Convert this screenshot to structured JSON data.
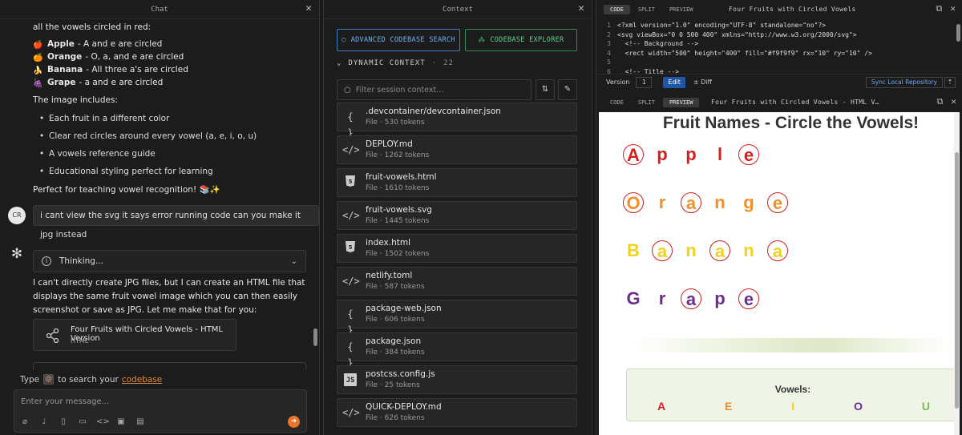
{
  "chat": {
    "header": "Chat",
    "intro_line": "all the vowels circled in red:",
    "fruits": [
      {
        "emoji": "🍎",
        "name": "Apple",
        "desc": "- A and e are circled"
      },
      {
        "emoji": "🍊",
        "name": "Orange",
        "desc": "- O, a, and e are circled"
      },
      {
        "emoji": "🍌",
        "name": "Banana",
        "desc": "- All three a's are circled"
      },
      {
        "emoji": "🍇",
        "name": "Grape",
        "desc": "- a and e are circled"
      }
    ],
    "includes_line": "The image includes:",
    "bullets": [
      "Each fruit in a different color",
      "Clear red circles around every vowel (a, e, i, o, u)",
      "A vowels reference guide",
      "Educational styling perfect for learning"
    ],
    "closing_line": "Perfect for teaching vowel recognition! 📚✨",
    "user_avatar": "CR",
    "user_message": "i cant view the svg it says error running code can you make it jpg instead",
    "thinking_label": "Thinking...",
    "ai_reply": "I can't directly create JPG files, but I can create an HTML file that displays the same fruit vowel image which you can then easily screenshot or save as JPG. Let me make that for you:",
    "artifact_title": "Four Fruits with Circled Vowels - HTML Version",
    "artifact_type": "HTML",
    "type_hint_pre": "Type",
    "type_hint_at": "@",
    "type_hint_mid": "to search your",
    "type_hint_link": "codebase",
    "input_placeholder": "Enter your message..."
  },
  "context": {
    "header": "Context",
    "search_btn": "ADVANCED CODEBASE SEARCH",
    "explorer_btn": "CODEBASE EXPLORER",
    "dynamic_label": "DYNAMIC CONTEXT",
    "dynamic_count": "22",
    "filter_placeholder": "Filter session context...",
    "files": [
      {
        "icon": "{ }",
        "name": ".devcontainer/devcontainer.json",
        "meta": "File · 530 tokens"
      },
      {
        "icon": "</>",
        "name": "DEPLOY.md",
        "meta": "File · 1262 tokens"
      },
      {
        "icon": "5",
        "name": "fruit-vowels.html",
        "meta": "File · 1610 tokens"
      },
      {
        "icon": "</>",
        "name": "fruit-vowels.svg",
        "meta": "File · 1445 tokens"
      },
      {
        "icon": "5",
        "name": "index.html",
        "meta": "File · 1502 tokens"
      },
      {
        "icon": "</>",
        "name": "netlify.toml",
        "meta": "File · 587 tokens"
      },
      {
        "icon": "{ }",
        "name": "package-web.json",
        "meta": "File · 606 tokens"
      },
      {
        "icon": "{ }",
        "name": "package.json",
        "meta": "File · 384 tokens"
      },
      {
        "icon": "JS",
        "name": "postcss.config.js",
        "meta": "File · 25 tokens"
      },
      {
        "icon": "</>",
        "name": "QUICK-DEPLOY.md",
        "meta": "File · 626 tokens"
      }
    ]
  },
  "code": {
    "tabs": [
      "CODE",
      "SPLIT",
      "PREVIEW"
    ],
    "title": "Four Fruits with Circled Vowels",
    "lines": [
      "<?xml version=\"1.0\" encoding=\"UTF-8\" standalone=\"no\"?>",
      "<svg viewBox=\"0 0 500 400\" xmlns=\"http://www.w3.org/2000/svg\">",
      "  <!-- Background -->",
      "  <rect width=\"500\" height=\"400\" fill=\"#f9f9f9\" rx=\"10\" ry=\"10\" />",
      "",
      "  <!-- Title -->"
    ],
    "version_label": "Version",
    "version_value": "1",
    "edit_label": "Edit",
    "diff_label": "± Diff",
    "sync_label": "Sync Local Repository",
    "preview_tabs": [
      "CODE",
      "SPLIT",
      "PREVIEW"
    ],
    "preview_title": "Four Fruits with Circled Vowels - HTML V…"
  },
  "preview": {
    "title": "Fruit Names - Circle the Vowels!",
    "words": [
      {
        "letters": [
          "A",
          "p",
          "p",
          "l",
          "e"
        ],
        "vowels": [
          0,
          4
        ],
        "color": "#d42020"
      },
      {
        "letters": [
          "O",
          "r",
          "a",
          "n",
          "g",
          "e"
        ],
        "vowels": [
          0,
          2,
          5
        ],
        "color": "#f0902a"
      },
      {
        "letters": [
          "B",
          "a",
          "n",
          "a",
          "n",
          "a"
        ],
        "vowels": [
          1,
          3,
          5
        ],
        "color": "#f2d11c"
      },
      {
        "letters": [
          "G",
          "r",
          "a",
          "p",
          "e"
        ],
        "vowels": [
          2,
          4
        ],
        "color": "#6b2d8f"
      }
    ],
    "vowels_title": "Vowels:",
    "vowels": [
      {
        "v": "A",
        "color": "#d42020"
      },
      {
        "v": "E",
        "color": "#f0902a"
      },
      {
        "v": "I",
        "color": "#f2d11c"
      },
      {
        "v": "O",
        "color": "#6b2d8f"
      },
      {
        "v": "U",
        "color": "#7cbf4a"
      }
    ]
  }
}
